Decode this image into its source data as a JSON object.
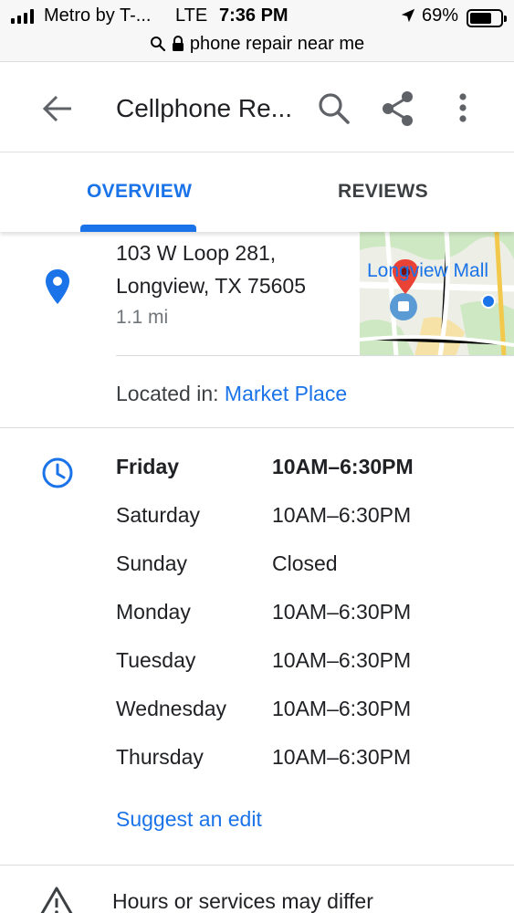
{
  "status_bar": {
    "carrier": "Metro by T-...",
    "network": "LTE",
    "time": "7:36 PM",
    "battery": "69%",
    "battery_level": 0.69
  },
  "browser": {
    "url": "phone repair near me"
  },
  "app_bar": {
    "title": "Cellphone Re..."
  },
  "tabs": [
    {
      "label": "OVERVIEW",
      "active": true
    },
    {
      "label": "REVIEWS",
      "active": false
    }
  ],
  "address": {
    "line1": "103 W Loop 281,",
    "line2": "Longview, TX 75605",
    "distance": "1.1 mi",
    "map_label": "Longview Mall",
    "located_prefix": "Located in: ",
    "located_link": "Market Place"
  },
  "hours": [
    {
      "day": "Friday",
      "time": "10AM–6:30PM",
      "today": true
    },
    {
      "day": "Saturday",
      "time": "10AM–6:30PM"
    },
    {
      "day": "Sunday",
      "time": "Closed"
    },
    {
      "day": "Monday",
      "time": "10AM–6:30PM"
    },
    {
      "day": "Tuesday",
      "time": "10AM–6:30PM"
    },
    {
      "day": "Wednesday",
      "time": "10AM–6:30PM"
    },
    {
      "day": "Thursday",
      "time": "10AM–6:30PM"
    }
  ],
  "suggest_edit": "Suggest an edit",
  "notice": "Hours or services may differ",
  "colors": {
    "accent": "#1a73e8",
    "pin": "#ea4335",
    "text": "#202124",
    "secondary": "#70757a"
  },
  "icons": [
    "signal-icon",
    "location-arrow-icon",
    "battery-icon",
    "search-icon",
    "lock-icon",
    "back-arrow-icon",
    "share-icon",
    "more-vert-icon",
    "location-pin-icon",
    "clock-icon",
    "warning-icon"
  ]
}
